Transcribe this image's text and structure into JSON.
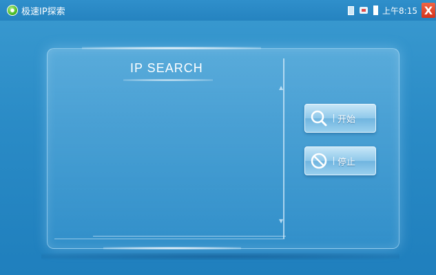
{
  "titlebar": {
    "app_icon": "app-logo-icon",
    "title": "极速IP探索",
    "time": "上午8:15",
    "status_icons": [
      "sd-card-icon",
      "network-icon",
      "battery-icon"
    ],
    "close_label": "X"
  },
  "panel": {
    "heading": "IP SEARCH",
    "scroll_icons": [
      "scroll-up-icon",
      "scroll-down-icon"
    ]
  },
  "buttons": {
    "start": {
      "label": "开始",
      "icon": "search-icon"
    },
    "stop": {
      "label": "停止",
      "icon": "stop-icon"
    }
  },
  "colors": {
    "background": "#2a8bc6",
    "titlebar": "#2583c0",
    "close_button": "#d6331c",
    "button_face": "#8ec8ea"
  }
}
